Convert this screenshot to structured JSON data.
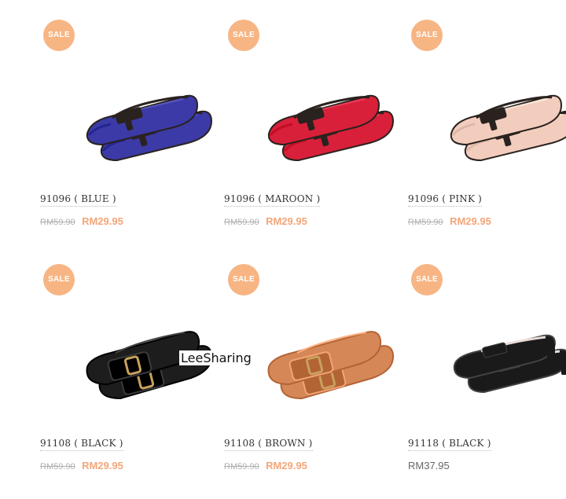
{
  "badge_label": "SALE",
  "products": [
    {
      "title": "91096 ( BLUE )",
      "old_price": "RM59.90",
      "price": "RM29.95",
      "shoe_color": "#3b3aa6",
      "trim_color": "#2a221e",
      "style": "bow-flat",
      "icon": "blue-bow-flat-shoe-image"
    },
    {
      "title": "91096 ( MAROON )",
      "old_price": "RM59.90",
      "price": "RM29.95",
      "shoe_color": "#d8203a",
      "trim_color": "#2a221e",
      "style": "bow-flat",
      "icon": "red-bow-flat-shoe-image"
    },
    {
      "title": "91096 ( PINK )",
      "old_price": "RM59.90",
      "price": "RM29.95",
      "shoe_color": "#f2cdbd",
      "trim_color": "#2a221e",
      "style": "bow-flat",
      "icon": "pink-bow-flat-shoe-image"
    },
    {
      "title": "91108 ( BLACK )",
      "old_price": "RM59.90",
      "price": "RM29.95",
      "shoe_color": "#1d1d1d",
      "trim_color": "#c9a15e",
      "style": "buckle-flat",
      "icon": "black-buckle-flat-shoe-image"
    },
    {
      "title": "91108 ( BROWN )",
      "old_price": "RM59.90",
      "price": "RM29.95",
      "shoe_color": "#d68757",
      "trim_color": "#c9a15e",
      "style": "buckle-flat",
      "icon": "brown-buckle-flat-shoe-image"
    },
    {
      "title": "91118 ( BLACK )",
      "old_price": "",
      "price": "RM37.95",
      "shoe_color": "#1a1a1a",
      "trim_color": "#2a221e",
      "style": "bow-heel",
      "icon": "black-bow-heel-shoe-image"
    }
  ],
  "watermark": "LeeSharing",
  "colors": {
    "badge": "#f7b584",
    "sale_price": "#f3a679",
    "old_price": "#b0b0b0",
    "regular_price": "#666666"
  }
}
